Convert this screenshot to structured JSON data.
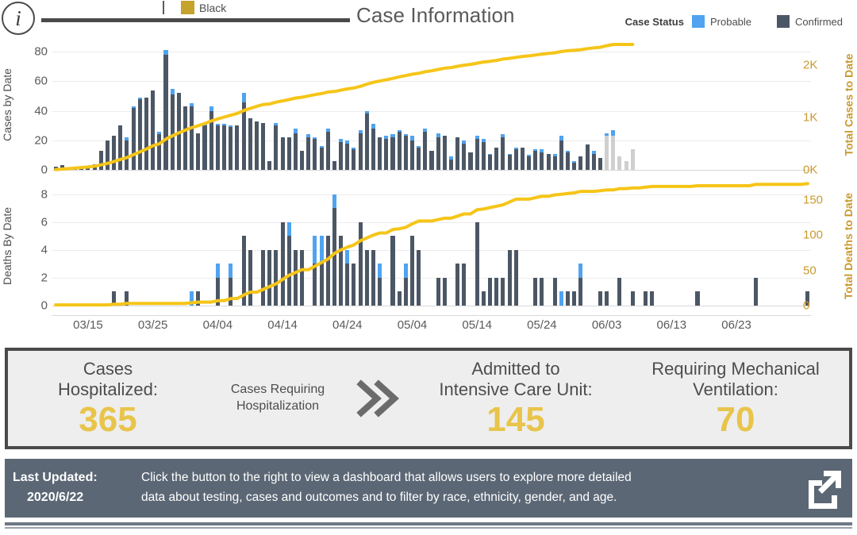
{
  "header": {
    "title": "Case Information",
    "info_icon": "info-icon",
    "orphan_legend": {
      "label": "Black",
      "color": "#c5a32c"
    },
    "case_status": {
      "title": "Case Status",
      "items": [
        {
          "label": "Probable",
          "color": "#4fa3ef"
        },
        {
          "label": "Confirmed",
          "color": "#4c5765"
        }
      ]
    }
  },
  "chart_data": [
    {
      "type": "bar",
      "title": "Cases by Date",
      "ylabel": "Cases by Date",
      "ylabel_right": "Total Cases to Date",
      "xlabel": "",
      "ylim": [
        0,
        85
      ],
      "yticks": [
        0,
        20,
        40,
        60,
        80
      ],
      "ylim_right": [
        0,
        2400
      ],
      "yticks_right": [
        "0K",
        "1K",
        "2K"
      ],
      "ytick_right_values": [
        0,
        1000,
        2000
      ],
      "grid": true,
      "legend_position": "top-right",
      "x_start": "2020-03-10",
      "x_tick_labels": [
        "03/15",
        "03/25",
        "04/04",
        "04/14",
        "04/24",
        "05/04",
        "05/14",
        "05/24",
        "06/03",
        "06/13",
        "06/23"
      ],
      "series": [
        {
          "name": "Confirmed",
          "color": "#4c5765",
          "values": [
            2,
            3,
            1,
            1,
            1,
            1,
            4,
            13,
            20,
            23,
            30,
            20,
            42,
            48,
            49,
            54,
            24,
            78,
            51,
            52,
            43,
            43,
            25,
            30,
            40,
            30,
            30,
            29,
            30,
            46,
            35,
            33,
            32,
            6,
            30,
            22,
            22,
            25,
            13,
            22,
            21,
            15,
            26,
            6,
            19,
            18,
            14,
            25,
            38,
            28,
            22,
            21,
            22,
            26,
            23,
            20,
            15,
            26,
            13,
            22,
            23,
            7,
            22,
            18,
            12,
            21,
            19,
            10,
            15,
            22,
            10,
            14,
            15,
            9,
            13,
            12,
            11,
            9,
            20,
            12,
            5,
            9,
            17,
            11,
            8,
            23,
            23,
            9,
            6,
            14
          ]
        },
        {
          "name": "Probable",
          "color": "#4fa3ef",
          "values": [
            0,
            0,
            0,
            0,
            0,
            0,
            0,
            0,
            0,
            0,
            0,
            2,
            1,
            1,
            0,
            0,
            2,
            3,
            4,
            0,
            0,
            2,
            0,
            1,
            3,
            1,
            1,
            1,
            0,
            6,
            0,
            0,
            0,
            0,
            2,
            0,
            0,
            3,
            0,
            2,
            1,
            1,
            2,
            0,
            2,
            2,
            1,
            2,
            2,
            3,
            0,
            2,
            2,
            1,
            1,
            3,
            1,
            2,
            0,
            3,
            0,
            2,
            0,
            2,
            0,
            2,
            2,
            1,
            0,
            2,
            1,
            1,
            0,
            1,
            1,
            2,
            0,
            2,
            3,
            1,
            1,
            0,
            0,
            2,
            0,
            2,
            4,
            0,
            0,
            0
          ]
        }
      ],
      "provisional_tail_start_index": 85,
      "provisional_color": "#cfcfcf",
      "cumulative_line": {
        "name": "Total Cases to Date",
        "color": "#f5c518",
        "values": [
          5,
          15,
          25,
          35,
          45,
          55,
          70,
          95,
          125,
          160,
          200,
          235,
          290,
          345,
          400,
          460,
          500,
          590,
          650,
          710,
          760,
          810,
          845,
          885,
          935,
          975,
          1010,
          1045,
          1080,
          1135,
          1175,
          1215,
          1250,
          1260,
          1295,
          1320,
          1345,
          1375,
          1390,
          1415,
          1440,
          1460,
          1490,
          1500,
          1525,
          1550,
          1568,
          1598,
          1640,
          1675,
          1700,
          1725,
          1750,
          1780,
          1805,
          1830,
          1848,
          1878,
          1895,
          1922,
          1946,
          1958,
          1982,
          2004,
          2018,
          2042,
          2065,
          2078,
          2095,
          2120,
          2134,
          2152,
          2170,
          2182,
          2198,
          2214,
          2228,
          2240,
          2265,
          2280,
          2288,
          2300,
          2320,
          2335,
          2345,
          2375,
          2400,
          2400,
          2400,
          2400
        ]
      }
    },
    {
      "type": "bar",
      "title": "Deaths By Date",
      "ylabel": "Deaths By Date",
      "ylabel_right": "Total Deaths to Date",
      "xlabel": "",
      "ylim": [
        0,
        8.6
      ],
      "yticks": [
        0,
        2,
        4,
        6,
        8
      ],
      "ylim_right": [
        0,
        170
      ],
      "yticks_right": [
        "0",
        "50",
        "100",
        "150"
      ],
      "ytick_right_values": [
        0,
        50,
        100,
        150
      ],
      "grid": true,
      "x_start": "2020-03-10",
      "series": [
        {
          "name": "Confirmed",
          "color": "#4c5765",
          "values": [
            0,
            0,
            0,
            0,
            0,
            0,
            0,
            0,
            0,
            1,
            0,
            1,
            0,
            0,
            0,
            0,
            0,
            0,
            0,
            0,
            0,
            0,
            1,
            0,
            0,
            2,
            0,
            2,
            0,
            5,
            4,
            0,
            4,
            4,
            4,
            6,
            5,
            4,
            4,
            0,
            3,
            3,
            5,
            7,
            5,
            3,
            3,
            6,
            4,
            4,
            2,
            0,
            5,
            1,
            2,
            5,
            4,
            0,
            0,
            2,
            2,
            0,
            3,
            3,
            0,
            6,
            1,
            2,
            2,
            2,
            4,
            4,
            0,
            0,
            2,
            2,
            0,
            2,
            0,
            1,
            1,
            2,
            0,
            0,
            1,
            1,
            0,
            2,
            0,
            1,
            0,
            1,
            1,
            0,
            0,
            0,
            0,
            0,
            0,
            1,
            0,
            0,
            0,
            0,
            0,
            0,
            0,
            0,
            2,
            0,
            0,
            0,
            0,
            0,
            0,
            0,
            1
          ]
        },
        {
          "name": "Probable",
          "color": "#4fa3ef",
          "values": [
            0,
            0,
            0,
            0,
            0,
            0,
            0,
            0,
            0,
            0,
            0,
            0,
            0,
            0,
            0,
            0,
            0,
            0,
            0,
            0,
            0,
            1,
            0,
            0,
            0,
            1,
            0,
            1,
            0,
            0,
            0,
            0,
            0,
            0,
            0,
            0,
            1,
            0,
            0,
            0,
            2,
            2,
            0,
            1,
            0,
            1,
            0,
            0,
            0,
            0,
            1,
            0,
            0,
            0,
            1,
            0,
            0,
            0,
            0,
            0,
            0,
            0,
            0,
            0,
            0,
            0,
            0,
            0,
            0,
            0,
            0,
            0,
            0,
            0,
            0,
            0,
            0,
            0,
            1,
            0,
            0,
            1,
            0,
            0,
            0,
            0,
            0,
            0,
            0,
            0,
            0,
            0,
            0,
            0,
            0,
            0,
            0,
            0,
            0,
            0,
            0,
            0,
            0,
            0,
            0,
            0,
            0,
            0,
            0,
            0,
            0,
            0,
            0,
            0,
            0,
            0,
            0
          ]
        }
      ],
      "cumulative_line": {
        "name": "Total Deaths to Date",
        "color": "#f5c518",
        "values": [
          1,
          1,
          1,
          1,
          1,
          1,
          1,
          1,
          1,
          2,
          2,
          3,
          3,
          3,
          3,
          3,
          3,
          3,
          3,
          3,
          3,
          4,
          5,
          5,
          5,
          7,
          7,
          10,
          10,
          15,
          19,
          19,
          23,
          27,
          31,
          37,
          43,
          47,
          51,
          51,
          56,
          61,
          66,
          74,
          79,
          83,
          86,
          92,
          96,
          100,
          103,
          103,
          108,
          109,
          111,
          116,
          120,
          120,
          120,
          122,
          124,
          124,
          127,
          130,
          130,
          136,
          137,
          139,
          141,
          143,
          147,
          151,
          151,
          151,
          153,
          155,
          155,
          157,
          158,
          159,
          160,
          162,
          162,
          162,
          163,
          164,
          164,
          166,
          166,
          167,
          167,
          168,
          169,
          169,
          169,
          169,
          169,
          169,
          169,
          170,
          170,
          170,
          170,
          170,
          170,
          170,
          170,
          170,
          172,
          172,
          172,
          172,
          172,
          172,
          172,
          172,
          173
        ]
      }
    }
  ],
  "xaxis": {
    "labels": [
      "03/15",
      "03/25",
      "04/04",
      "04/14",
      "04/24",
      "05/04",
      "05/14",
      "05/24",
      "06/03",
      "06/13",
      "06/23"
    ]
  },
  "kpi": {
    "hospitalized": {
      "label_line1": "Cases",
      "label_line2": "Hospitalized:",
      "value": "365"
    },
    "connector_text_line1": "Cases Requiring",
    "connector_text_line2": "Hospitalization",
    "chevron_icon": "double-chevron-right-icon",
    "icu": {
      "label_line1": "Admitted to",
      "label_line2": "Intensive Care Unit:",
      "value": "145"
    },
    "ventilation": {
      "label_line1": "Requiring Mechanical",
      "label_line2": "Ventilation:",
      "value": "70"
    }
  },
  "footer": {
    "last_updated_label": "Last Updated:",
    "last_updated_date": "2020/6/22",
    "message_line1": "Click the button to the right to view a dashboard that allows users to explore more detailed",
    "message_line2": "data about testing, cases and outcomes and to filter by race, ethnicity, gender, and age.",
    "button_icon": "external-link-icon"
  },
  "colors": {
    "confirmed": "#4c5765",
    "probable": "#4fa3ef",
    "provisional": "#cfcfcf",
    "cumulative_line": "#f5c518",
    "kpi_value": "#e8c44a",
    "footer_bg": "#5b6775",
    "axis_right_text": "#c99a2e"
  }
}
